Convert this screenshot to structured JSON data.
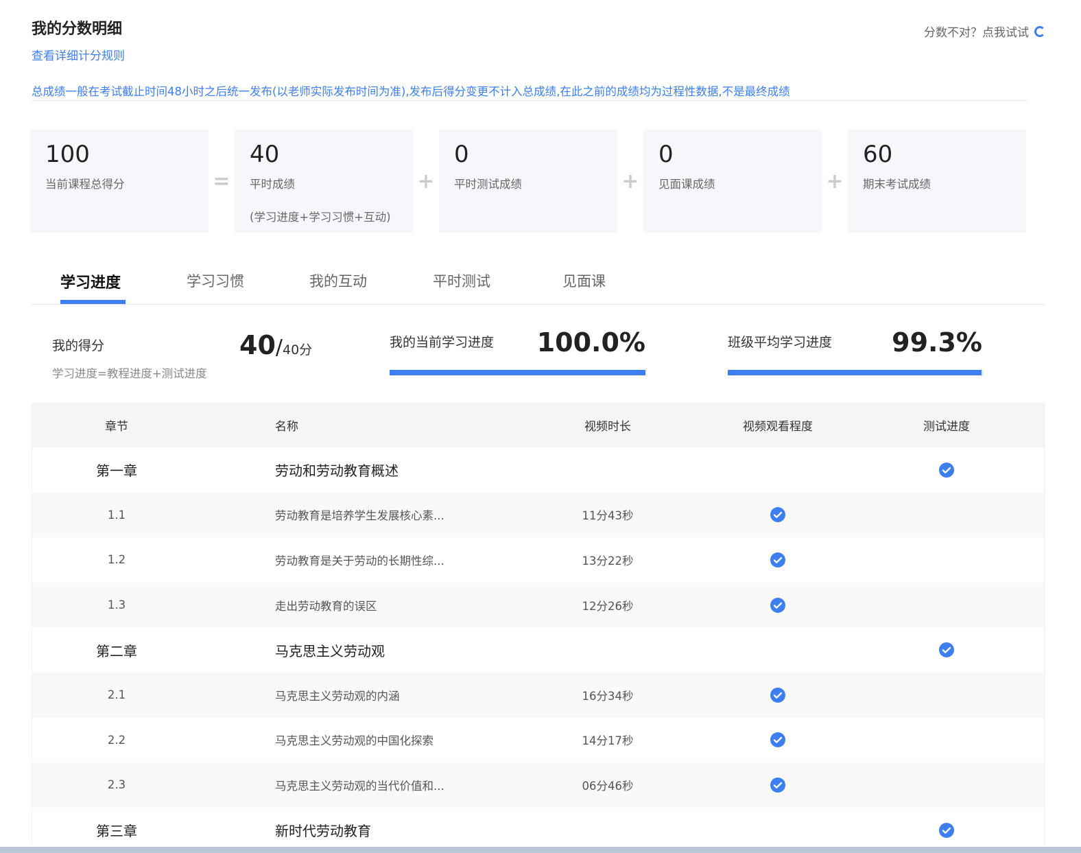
{
  "header": {
    "title": "我的分数明细",
    "rule_link": "查看详细计分规则",
    "retry_text": "分数不对？点我试试",
    "notice": "总成绩一般在考试截止时间48小时之后统一发布(以老师实际发布时间为准),发布后得分变更不计入总成绩,在此之前的成绩均为过程性数据,不是最终成绩"
  },
  "scores": [
    {
      "value": "100",
      "label": "当前课程总得分",
      "sub": ""
    },
    {
      "value": "40",
      "label": "平时成绩",
      "sub": "(学习进度+学习习惯+互动)"
    },
    {
      "value": "0",
      "label": "平时测试成绩",
      "sub": ""
    },
    {
      "value": "0",
      "label": "见面课成绩",
      "sub": ""
    },
    {
      "value": "60",
      "label": "期末考试成绩",
      "sub": ""
    }
  ],
  "operators": [
    "=",
    "+",
    "+",
    "+"
  ],
  "tabs": [
    {
      "label": "学习进度",
      "active": true
    },
    {
      "label": "学习习惯",
      "active": false
    },
    {
      "label": "我的互动",
      "active": false
    },
    {
      "label": "平时测试",
      "active": false
    },
    {
      "label": "见面课",
      "active": false
    }
  ],
  "summary": {
    "my_score_label": "我的得分",
    "formula": "学习进度=教程进度+测试进度",
    "score": "40",
    "score_total": "/",
    "score_max": "40分",
    "my_progress_label": "我的当前学习进度",
    "my_progress_value": "100.0%",
    "my_progress_fraction": 1.0,
    "class_progress_label": "班级平均学习进度",
    "class_progress_value": "99.3%",
    "class_progress_fraction": 0.993
  },
  "table": {
    "headers": [
      "章节",
      "名称",
      "视频时长",
      "视频观看程度",
      "测试进度"
    ],
    "rows": [
      {
        "type": "chapter",
        "num": "第一章",
        "name": "劳动和劳动教育概述",
        "duration": "",
        "watched": false,
        "tested": true
      },
      {
        "type": "section",
        "num": "1.1",
        "name": "劳动教育是培养学生发展核心素...",
        "duration": "11分43秒",
        "watched": true,
        "tested": false
      },
      {
        "type": "section",
        "num": "1.2",
        "name": "劳动教育是关于劳动的长期性综...",
        "duration": "13分22秒",
        "watched": true,
        "tested": false
      },
      {
        "type": "section",
        "num": "1.3",
        "name": "走出劳动教育的误区",
        "duration": "12分26秒",
        "watched": true,
        "tested": false
      },
      {
        "type": "chapter",
        "num": "第二章",
        "name": "马克思主义劳动观",
        "duration": "",
        "watched": false,
        "tested": true
      },
      {
        "type": "section",
        "num": "2.1",
        "name": "马克思主义劳动观的内涵",
        "duration": "16分34秒",
        "watched": true,
        "tested": false
      },
      {
        "type": "section",
        "num": "2.2",
        "name": "马克思主义劳动观的中国化探索",
        "duration": "14分17秒",
        "watched": true,
        "tested": false
      },
      {
        "type": "section",
        "num": "2.3",
        "name": "马克思主义劳动观的当代价值和...",
        "duration": "06分46秒",
        "watched": true,
        "tested": false
      },
      {
        "type": "chapter",
        "num": "第三章",
        "name": "新时代劳动教育",
        "duration": "",
        "watched": false,
        "tested": true
      }
    ]
  },
  "colors": {
    "accent": "#3d7ef0",
    "card_bg": "#f5f7fa",
    "header_bg": "#f5f5f5"
  }
}
